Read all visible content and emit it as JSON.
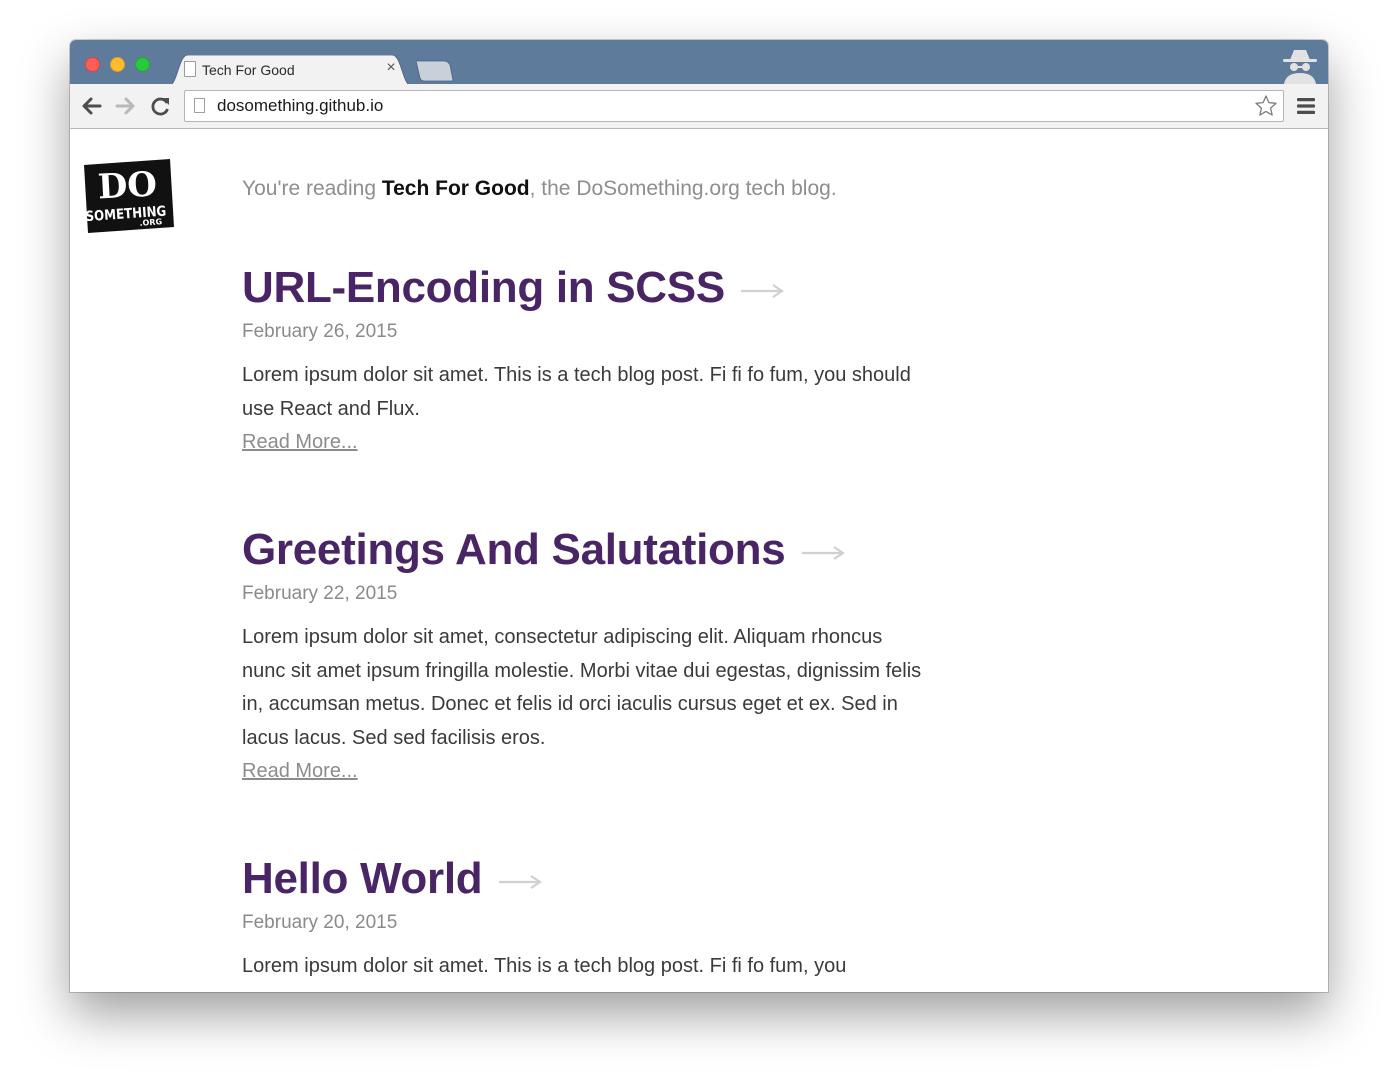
{
  "browser": {
    "tab_title": "Tech For Good",
    "tab_close": "×",
    "url": "dosomething.github.io"
  },
  "header": {
    "prefix": "You're reading ",
    "blog_name": "Tech For Good",
    "suffix": ", the DoSomething.org tech blog."
  },
  "posts": [
    {
      "title": "URL-Encoding in SCSS",
      "date": "February 26, 2015",
      "excerpt": "Lorem ipsum dolor sit amet. This is a tech blog post. Fi fi fo fum, you should use React and Flux.",
      "read_more": "Read More..."
    },
    {
      "title": "Greetings And Salutations",
      "date": "February 22, 2015",
      "excerpt": "Lorem ipsum dolor sit amet, consectetur adipiscing elit. Aliquam rhoncus nunc sit amet ipsum fringilla molestie. Morbi vitae dui egestas, dignissim felis in, accumsan metus. Donec et felis id orci iaculis cursus eget et ex. Sed in lacus lacus. Sed sed facilisis eros.",
      "read_more": "Read More..."
    },
    {
      "title": "Hello World",
      "date": "February 20, 2015",
      "excerpt": "Lorem ipsum dolor sit amet. This is a tech blog post. Fi fi fo fum, you"
    }
  ],
  "logo": {
    "line1": "DO",
    "line2": "SOMETHING",
    "line3": ".ORG"
  },
  "colors": {
    "title_purple": "#4a2565",
    "tabstrip": "#5f7b9b"
  }
}
